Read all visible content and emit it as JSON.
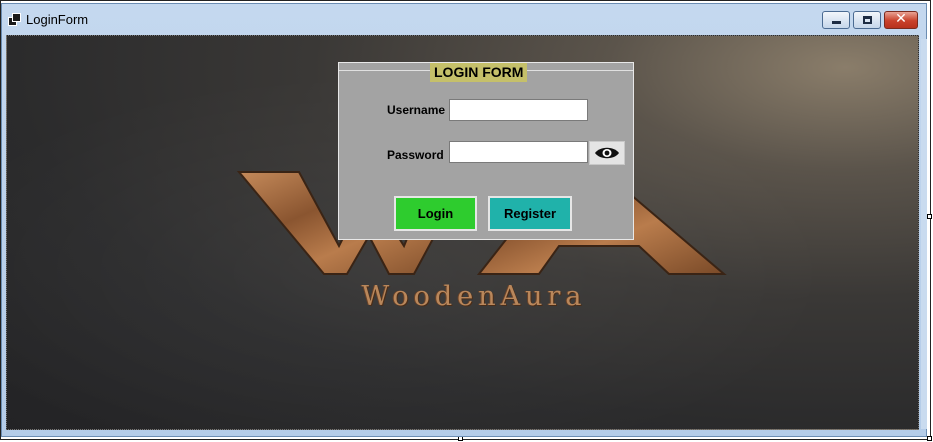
{
  "window": {
    "title": "LoginForm",
    "icons": {
      "app": "form-app-icon",
      "minimize": "minimize-icon",
      "maximize": "maximize-icon",
      "close": "close-icon"
    },
    "close_glyph": "✕"
  },
  "background": {
    "brand_monogram": "WA",
    "brand_name": "WoodenAura"
  },
  "login": {
    "group_title": "LOGIN FORM",
    "username_label": "Username",
    "username_value": "",
    "password_label": "Password",
    "password_value": "",
    "show_password_icon": "eye-icon",
    "login_button": "Login",
    "register_button": "Register"
  },
  "colors": {
    "login_button": "#2ecc2e",
    "register_button": "#20b2aa",
    "panel": "#a3a3a3",
    "legend": "#c5c06a",
    "brand": "#b9875b"
  }
}
